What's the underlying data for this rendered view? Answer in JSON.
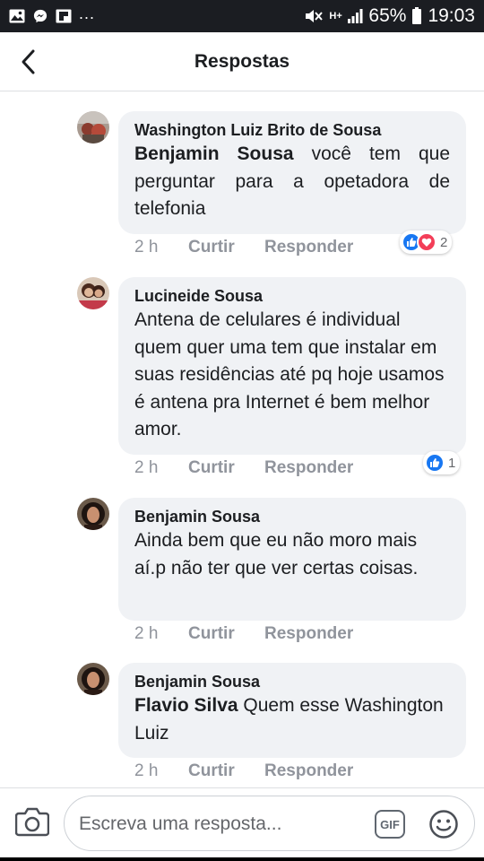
{
  "status_bar": {
    "overflow": "...",
    "network": "H+",
    "battery": "65%",
    "time": "19:03",
    "icons": [
      "gallery-icon",
      "messenger-icon",
      "flipboard-icon",
      "mute-icon",
      "signal-icon",
      "battery-icon"
    ]
  },
  "header": {
    "title": "Respostas",
    "back_icon": "chevron-left-icon"
  },
  "comments": [
    {
      "author": "Washington Luiz Brito de Sousa",
      "mention": "Benjamin Sousa",
      "text": " você tem que perguntar para a opetadora de telefonia",
      "time": "2 h",
      "like": "Curtir",
      "reply": "Responder",
      "reactions": [
        "like",
        "love"
      ],
      "reaction_count": "2"
    },
    {
      "author": "Lucineide Sousa",
      "text": "Antena de celulares é individual quem quer uma tem que instalar em suas residências até pq hoje usamos é antena pra Internet é bem melhor amor.",
      "time": "2 h",
      "like": "Curtir",
      "reply": "Responder",
      "reactions": [
        "like"
      ],
      "reaction_count": "1"
    },
    {
      "author": "Benjamin Sousa",
      "text": "Ainda bem que eu não moro mais aí.p não ter que ver certas coisas.",
      "time": "2 h",
      "like": "Curtir",
      "reply": "Responder"
    },
    {
      "author": "Benjamin Sousa",
      "mention": "Flavio Silva",
      "text": " Quem esse Washington Luiz",
      "time": "2 h",
      "like": "Curtir",
      "reply": "Responder"
    }
  ],
  "composer": {
    "placeholder": "Escreva uma resposta...",
    "gif_label": "GIF",
    "camera_icon": "camera-icon",
    "emoji_icon": "smiley-icon"
  },
  "colors": {
    "bubble": "#f0f2f5",
    "like_blue": "#1877f2",
    "love_red": "#f33e58",
    "meta_gray": "#90949c",
    "status_bar": "#1b1d22"
  }
}
